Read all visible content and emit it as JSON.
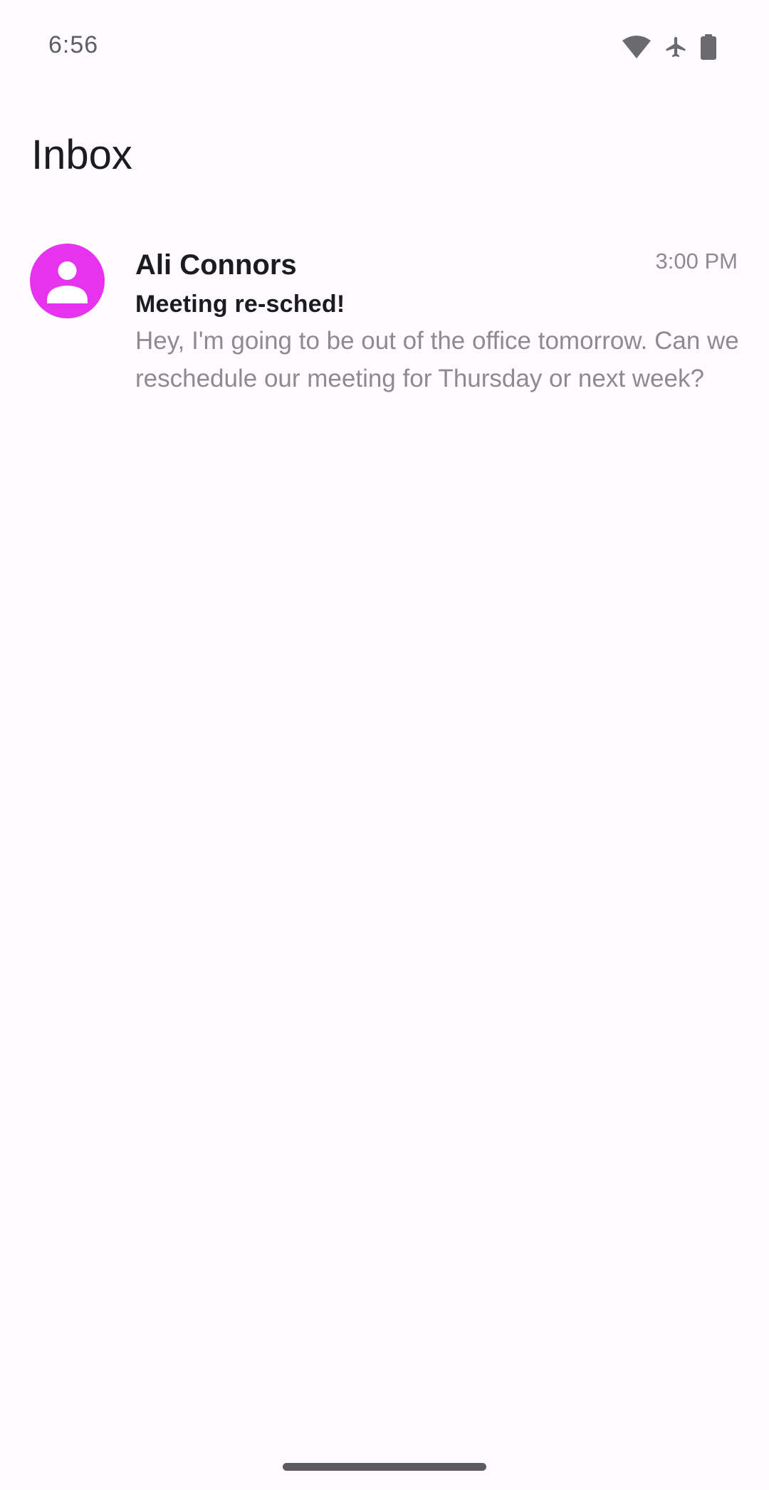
{
  "status_bar": {
    "time": "6:56",
    "icons": [
      "wifi-icon",
      "airplane-mode-icon",
      "battery-icon"
    ],
    "icon_color": "#6b6b6f"
  },
  "header": {
    "title": "Inbox"
  },
  "messages": [
    {
      "avatar_icon": "person-icon",
      "avatar_color": "#e533ef",
      "sender": "Ali Connors",
      "time": "3:00 PM",
      "subject": "Meeting re-sched!",
      "preview": "Hey, I'm going to be out of the office tomorrow. Can we reschedule our meeting for Thursday or next week?"
    }
  ],
  "colors": {
    "background": "#fdfbfe",
    "primary_text": "#1c1b1f",
    "secondary_text": "#8d8a91",
    "nav_handle": "#5c5c60"
  }
}
